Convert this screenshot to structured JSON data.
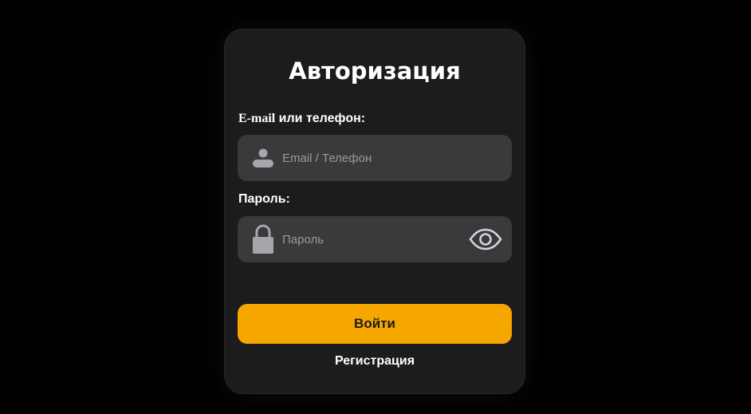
{
  "form": {
    "title": "Авторизация",
    "login_label_prefix": "E-mail",
    "login_label_suffix": " или телефон:",
    "login_placeholder": "Email / Телефон",
    "password_label": "Пароль:",
    "password_placeholder": "Пароль",
    "submit_label": "Войти",
    "register_link": "Регистрация"
  },
  "icons": {
    "login_field": "user-icon",
    "password_field": "lock-icon",
    "password_toggle": "eye-icon"
  },
  "colors": {
    "page_background": "#000000",
    "card_background": "#1c1c1f",
    "field_background": "#3a3a3d",
    "accent": "#f5a700",
    "icon": "#a6a6aa"
  }
}
